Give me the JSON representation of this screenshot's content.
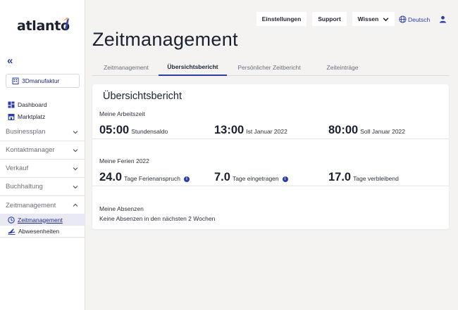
{
  "sidebar": {
    "logo": "atlanto",
    "company": "3Dmanufaktur",
    "links": [
      {
        "label": "Dashboard",
        "icon": "dashboard-icon"
      },
      {
        "label": "Marktplatz",
        "icon": "store-icon"
      }
    ],
    "sections": [
      {
        "label": "Businessplan",
        "expanded": false
      },
      {
        "label": "Kontaktmanager",
        "expanded": false
      },
      {
        "label": "Verkauf",
        "expanded": false
      },
      {
        "label": "Buchhaltung",
        "expanded": false
      },
      {
        "label": "Zeitmanagement",
        "expanded": true
      }
    ],
    "subitems": [
      {
        "label": "Zeitmanagement",
        "icon": "clock-icon",
        "active": true
      },
      {
        "label": "Abwesenheiten",
        "icon": "plane-icon",
        "active": false
      }
    ]
  },
  "header": {
    "settings": "Einstellungen",
    "support": "Support",
    "knowledge": "Wissen",
    "language": "Deutsch"
  },
  "page": {
    "title": "Zeitmanagement",
    "tabs": [
      {
        "label": "Zeitmanagement",
        "active": false
      },
      {
        "label": "Übersichtsbericht",
        "active": true
      },
      {
        "label": "Persönlicher Zeitbericht",
        "active": false
      },
      {
        "label": "Zeiteinträge",
        "active": false
      }
    ]
  },
  "report": {
    "title": "Übersichtsbericht",
    "worktime": {
      "label": "Meine Arbeitszeit",
      "stats": [
        {
          "value": "05:00",
          "unit": "Stundensaldo"
        },
        {
          "value": "13:00",
          "unit": "Ist Januar 2022"
        },
        {
          "value": "80:00",
          "unit": "Soll Januar 2022"
        }
      ]
    },
    "vacation": {
      "label": "Meine Ferien 2022",
      "stats": [
        {
          "value": "24.0",
          "unit": "Tage Ferienanspruch",
          "info": true
        },
        {
          "value": "7.0",
          "unit": "Tage eingetragen",
          "info": true
        },
        {
          "value": "17.0",
          "unit": "Tage verbleibend",
          "info": false
        }
      ]
    },
    "absences": {
      "label": "Meine Absenzen",
      "text": "Keine Absenzen in den nächsten 2 Wochen"
    }
  },
  "colors": {
    "accent": "#2a3da8",
    "background": "#f4f3f1",
    "card": "#ffffff"
  }
}
